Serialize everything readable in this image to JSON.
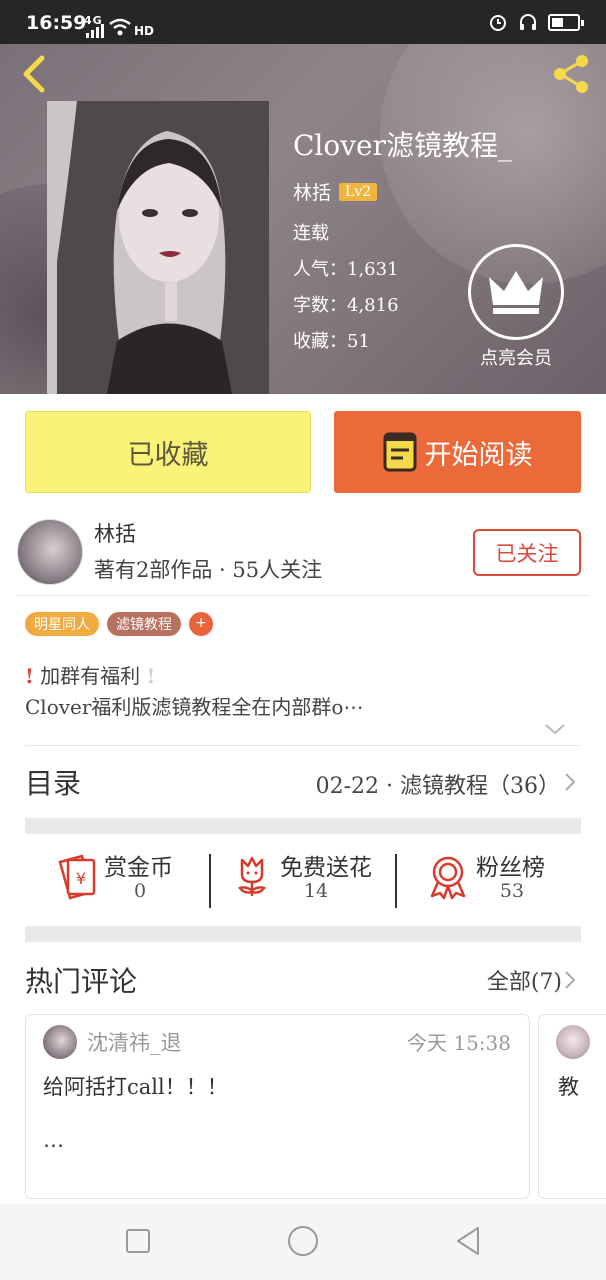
{
  "status_bar": {
    "time": "16:59",
    "network": "4G",
    "wifi_label": "HD",
    "battery_level": 0.45
  },
  "header": {
    "back_icon": "chevron-left-icon",
    "share_icon": "share-icon"
  },
  "book": {
    "title": "Clover滤镜教程_",
    "author": "林括",
    "level": "Lv2",
    "status": "连载",
    "popularity_label": "人气：",
    "popularity": "1,631",
    "word_count_label": "字数：",
    "word_count": "4,816",
    "favorites_label": "收藏：",
    "favorites": "51",
    "vip_label": "点亮会员"
  },
  "actions": {
    "collected_label": "已收藏",
    "read_label": "开始阅读"
  },
  "author_card": {
    "name": "林括",
    "meta": "著有2部作品 · 55人关注",
    "follow_label": "已关注"
  },
  "tags": [
    "明星同人",
    "滤镜教程",
    "+"
  ],
  "intro": {
    "line1": "加群有福利",
    "line2": "Clover福利版滤镜教程全在内部群o⋯"
  },
  "toc": {
    "label": "目录",
    "latest": "02-22 · 滤镜教程（36）"
  },
  "stats": [
    {
      "icon": "red-envelope-icon",
      "name": "赏金币",
      "value": "0"
    },
    {
      "icon": "flower-icon",
      "name": "免费送花",
      "value": "14"
    },
    {
      "icon": "rosette-icon",
      "name": "粉丝榜",
      "value": "53"
    }
  ],
  "comments": {
    "title": "热门评论",
    "all_label": "全部(7)",
    "items": [
      {
        "user": "沈清祎_退",
        "time": "今天 15:38",
        "text": "给阿括打call！！！",
        "more": "⋯"
      },
      {
        "user": "",
        "time": "",
        "text": "教",
        "more": ""
      }
    ]
  },
  "colors": {
    "accent_orange": "#ec6a3a",
    "collected_yellow": "#fbf27a",
    "follow_red": "#d9493b",
    "level_badge": "#f1b43c"
  }
}
